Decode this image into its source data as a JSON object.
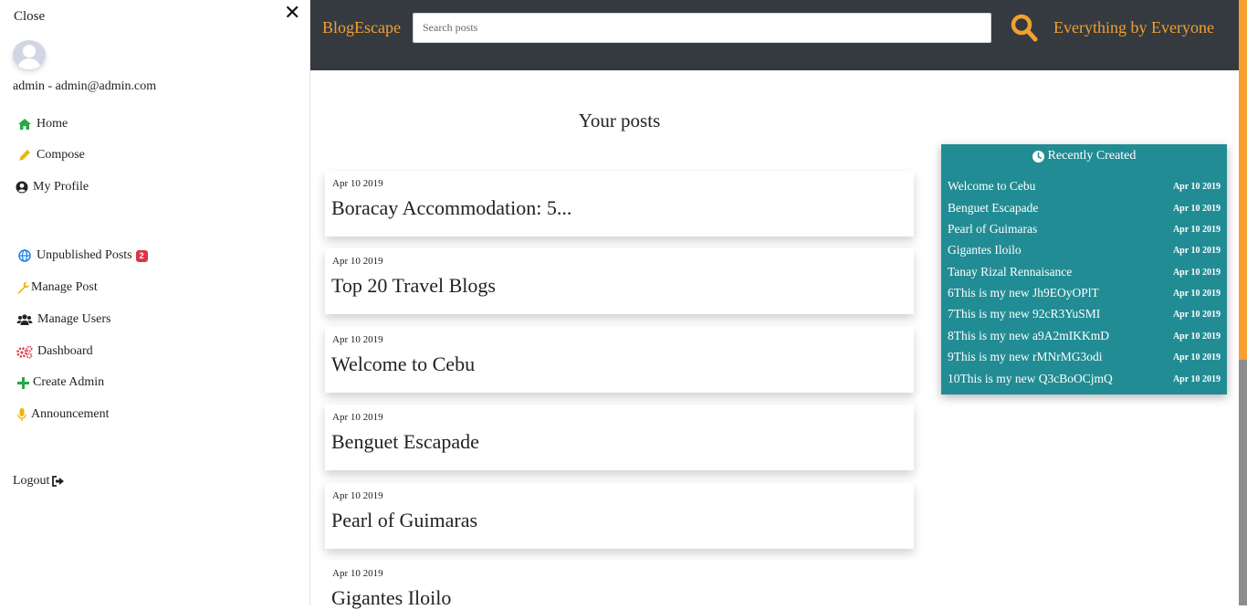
{
  "sidebar": {
    "close_label": "Close",
    "close_symbol": "✕",
    "user_text": "admin - admin@admin.com",
    "nav": [
      {
        "label": "Home",
        "icon": "home-icon",
        "color": "#28a745"
      },
      {
        "label": "Compose",
        "icon": "pencil-icon",
        "color": "#f0b400"
      },
      {
        "label": "My Profile",
        "icon": "user-circle-icon",
        "color": "#222222"
      }
    ],
    "admin_nav": [
      {
        "label": "Unpublished Posts",
        "icon": "globe-icon",
        "color": "#1e7ee4",
        "badge": "2"
      },
      {
        "label": "Manage Post",
        "icon": "wrench-icon",
        "color": "#f0b400"
      },
      {
        "label": "Manage Users",
        "icon": "users-icon",
        "color": "#222222"
      },
      {
        "label": "Dashboard",
        "icon": "cogs-icon",
        "color": "#dc3545"
      },
      {
        "label": "Create Admin",
        "icon": "plus-icon",
        "color": "#28a745"
      },
      {
        "label": "Announcement",
        "icon": "microphone-icon",
        "color": "#f0b400"
      }
    ],
    "logout_label": "Logout"
  },
  "navbar": {
    "brand": "BlogEscape",
    "search_placeholder": "Search posts",
    "tagline": "Everything by Everyone",
    "accent_color": "#f0a030",
    "background": "#343a40"
  },
  "main": {
    "title": "Your posts",
    "posts": [
      {
        "date": "Apr 10 2019",
        "title": "Boracay Accommodation: 5..."
      },
      {
        "date": "Apr 10 2019",
        "title": "Top 20 Travel Blogs"
      },
      {
        "date": "Apr 10 2019",
        "title": "Welcome to Cebu"
      },
      {
        "date": "Apr 10 2019",
        "title": "Benguet Escapade"
      },
      {
        "date": "Apr 10 2019",
        "title": "Pearl of Guimaras"
      },
      {
        "date": "Apr 10 2019",
        "title": "Gigantes Iloilo"
      }
    ]
  },
  "recent": {
    "heading": "Recently Created",
    "background": "#228c94",
    "items": [
      {
        "title": "Welcome to Cebu",
        "date": "Apr 10 2019"
      },
      {
        "title": "Benguet Escapade",
        "date": "Apr 10 2019"
      },
      {
        "title": "Pearl of Guimaras",
        "date": "Apr 10 2019"
      },
      {
        "title": "Gigantes Iloilo",
        "date": "Apr 10 2019"
      },
      {
        "title": "Tanay Rizal Rennaisance",
        "date": "Apr 10 2019"
      },
      {
        "title": "6This is my new Jh9EOyOPlT",
        "date": "Apr 10 2019"
      },
      {
        "title": "7This is my new 92cR3YuSMI",
        "date": "Apr 10 2019"
      },
      {
        "title": "8This is my new a9A2mIKKmD",
        "date": "Apr 10 2019"
      },
      {
        "title": "9This is my new rMNrMG3odi",
        "date": "Apr 10 2019"
      },
      {
        "title": "10This is my new Q3cBoOCjmQ",
        "date": "Apr 10 2019"
      }
    ]
  }
}
